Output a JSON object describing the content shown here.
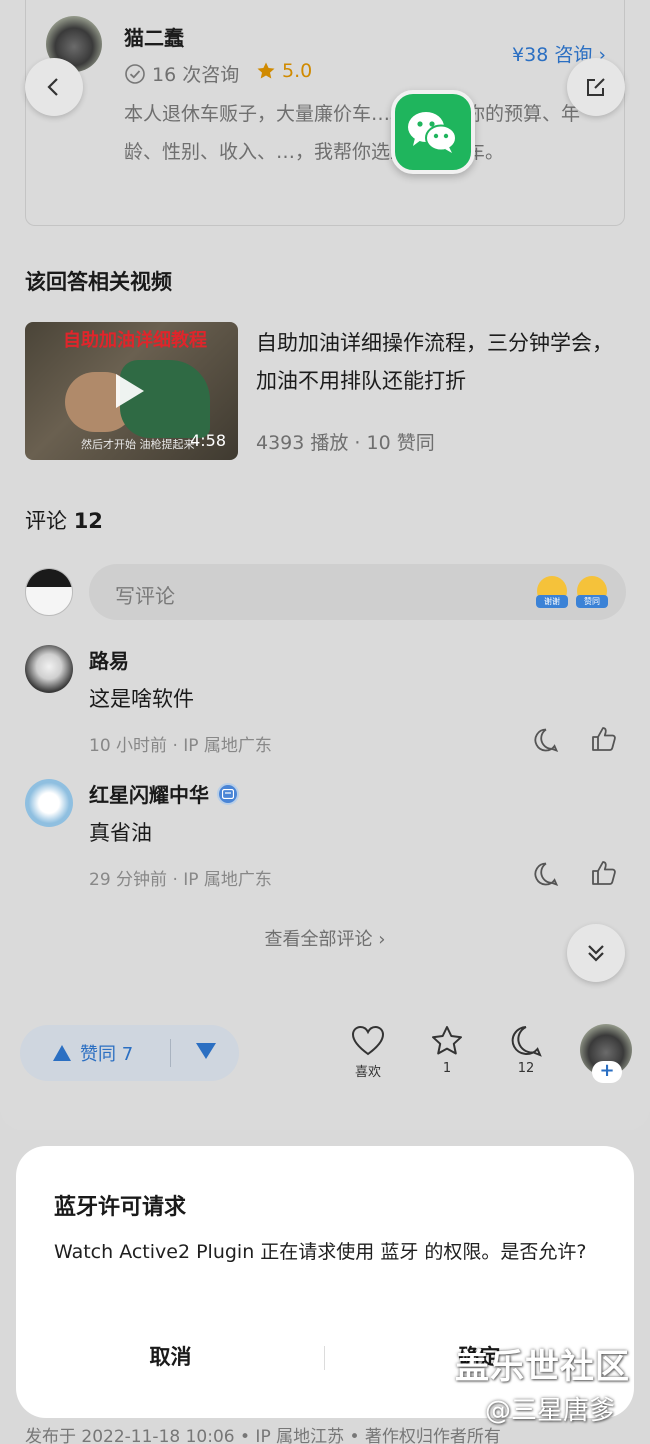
{
  "author": {
    "name": "猫二蠢",
    "consult_count": "16 次咨询",
    "rating": "5.0",
    "price_link": "¥38 咨询 ›",
    "bio": "本人退休车贩子，大量廉价车…。告诉我你的预算、年龄、性别、收入、…，我帮你选最适合的车。"
  },
  "related": {
    "section_title": "该回答相关视频",
    "video": {
      "thumb_title": "自助加油详细教程",
      "thumb_caption": "然后才开始 油枪提起来",
      "duration": "4:58",
      "title": "自助加油详细操作流程，三分钟学会，加油不用排队还能打折",
      "meta": "4393 播放 · 10 赞同"
    }
  },
  "comments": {
    "label": "评论",
    "count": "12",
    "input_placeholder": "写评论",
    "emoji_tags": [
      "谢谢",
      "赞同"
    ],
    "items": [
      {
        "name": "路易",
        "text": "这是啥软件",
        "meta": "10 小时前 · IP 属地广东"
      },
      {
        "name": "红星闪耀中华",
        "text": "真省油",
        "meta": "29 分钟前 · IP 属地广东"
      }
    ],
    "view_all": "查看全部评论 ›"
  },
  "actions": {
    "upvote_label": "赞同 7",
    "like_label": "喜欢",
    "favorite_count": "1",
    "comment_count": "12",
    "follow_plus": "+"
  },
  "footer": {
    "meta": "发布于 2022-11-18 10:06 • IP 属地江苏 • 著作权归作者所有"
  },
  "dialog": {
    "title": "蓝牙许可请求",
    "message": "Watch Active2 Plugin 正在请求使用 蓝牙 的权限。是否允许?",
    "cancel": "取消",
    "confirm": "确定"
  },
  "watermark": {
    "main": "盖乐世社区",
    "sub": "@三星唐爹"
  },
  "colors": {
    "accent_blue": "#2b6fc2",
    "rating_orange": "#d08a00",
    "wechat_green": "#1fb55d"
  }
}
